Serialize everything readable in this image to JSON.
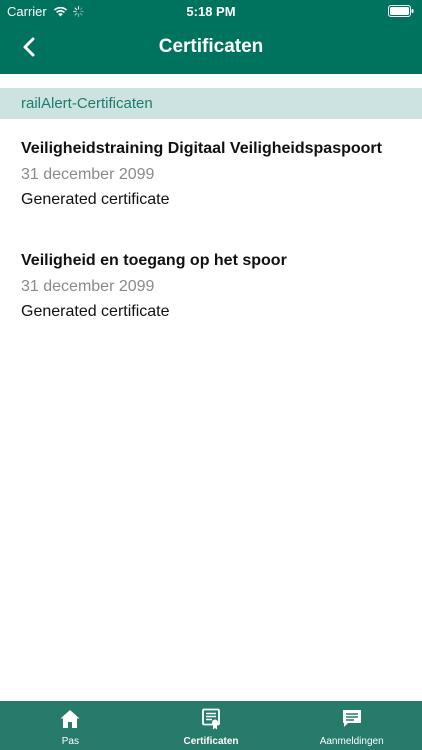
{
  "status_bar": {
    "carrier": "Carrier",
    "time": "5:18 PM"
  },
  "nav": {
    "title": "Certificaten"
  },
  "section": {
    "title": "railAlert-Certificaten"
  },
  "certificates": [
    {
      "title": "Veiligheidstraining Digitaal Veiligheidspaspoort",
      "date": "31 december 2099",
      "status": "Generated certificate"
    },
    {
      "title": "Veiligheid en toegang op het spoor",
      "date": "31 december 2099",
      "status": "Generated certificate"
    }
  ],
  "tabs": [
    {
      "label": "Pas",
      "icon": "home-icon",
      "active": false
    },
    {
      "label": "Certificaten",
      "icon": "certificate-icon",
      "active": true
    },
    {
      "label": "Aanmeldingen",
      "icon": "chat-bubble-icon",
      "active": false
    }
  ],
  "colors": {
    "header": "#00735e",
    "section_bg": "#cde3e1",
    "section_text": "#1d7c6c",
    "tab_bar": "#267b6b"
  }
}
